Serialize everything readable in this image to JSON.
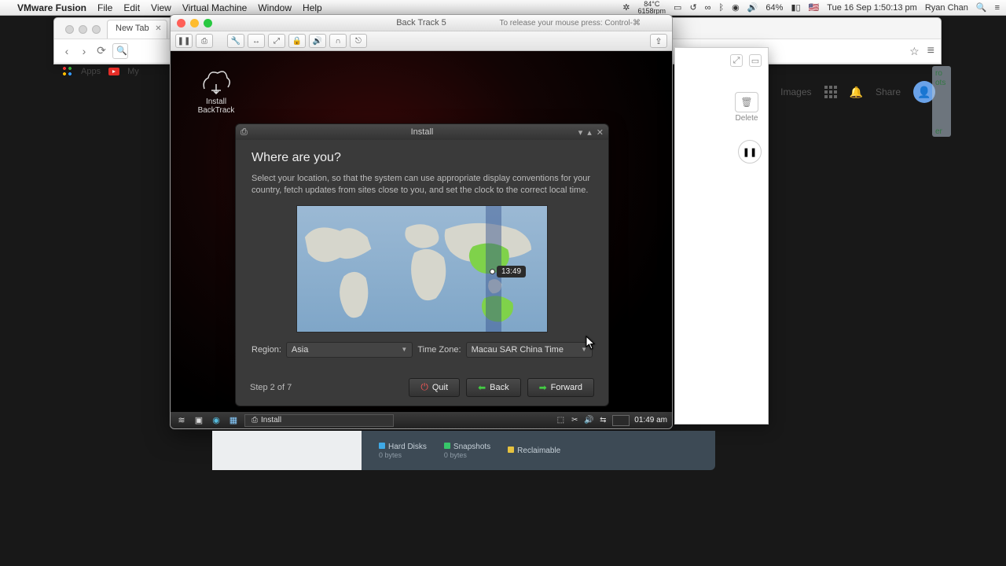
{
  "menubar": {
    "app": "VMware Fusion",
    "items": [
      "File",
      "Edit",
      "View",
      "Virtual Machine",
      "Window",
      "Help"
    ],
    "temp_top": "84°C",
    "temp_bot": "6158rpm",
    "battery": "64%",
    "flag": "🇺🇸",
    "clock": "Tue 16 Sep  1:50:13 pm",
    "user": "Ryan Chan"
  },
  "chrome": {
    "tab": "New Tab",
    "bookmarks_apps": "Apps",
    "bookmarks_my": "My"
  },
  "vm": {
    "title": "Back Track 5",
    "hint": "To release your mouse press: Control-⌘"
  },
  "bt_icon": {
    "line1": "Install",
    "line2": "BackTrack"
  },
  "inst": {
    "title": "Install",
    "heading": "Where are you?",
    "desc": "Select your location, so that the system can use appropriate display conventions for your country, fetch updates from sites close to you, and set the clock to the correct local time.",
    "map_time": "13:49",
    "region_label": "Region:",
    "region_value": "Asia",
    "tz_label": "Time Zone:",
    "tz_value": "Macau SAR China Time",
    "step": "Step 2 of 7",
    "btn_quit": "Quit",
    "btn_back": "Back",
    "btn_forward": "Forward"
  },
  "guestbar": {
    "task": "Install",
    "clock": "01:49 am"
  },
  "rightfrag": {
    "delete": "Delete"
  },
  "rightfrag2": {
    "images": "Images",
    "share": "Share"
  },
  "lib": {
    "a_label": "Hard Disks",
    "a_sub": "0 bytes",
    "b_label": "Snapshots",
    "b_sub": "0 bytes",
    "c_label": "Reclaimable"
  },
  "sliver": {
    "a": "ro",
    "b": "ots",
    "c": "er"
  }
}
